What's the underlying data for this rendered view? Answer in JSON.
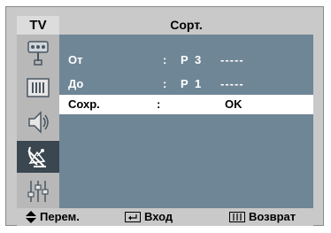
{
  "header": {
    "source_label": "TV",
    "title": "Сорт."
  },
  "sidebar": {
    "items": [
      {
        "icon": "antenna-icon",
        "active": false
      },
      {
        "icon": "picture-icon",
        "active": false
      },
      {
        "icon": "speaker-icon",
        "active": false
      },
      {
        "icon": "satellite-channel-icon",
        "active": true
      },
      {
        "icon": "equalizer-setup-icon",
        "active": false
      }
    ]
  },
  "menu": {
    "rows": [
      {
        "label": "От",
        "colon": ":",
        "channel": "P 3",
        "name": "-----"
      },
      {
        "label": "До",
        "colon": ":",
        "channel": "P 1",
        "name": "-----"
      },
      {
        "label": "Сохр.",
        "colon": ":",
        "value": "OK",
        "selected": true
      }
    ]
  },
  "footer": {
    "move_label": "Перем.",
    "enter_label": "Вход",
    "return_label": "Возврат"
  },
  "colors": {
    "frame": "#c9c9c9",
    "content_bg": "#6f8696",
    "selected_row_bg": "#ffffff",
    "active_icon_bg": "#3a4650"
  }
}
